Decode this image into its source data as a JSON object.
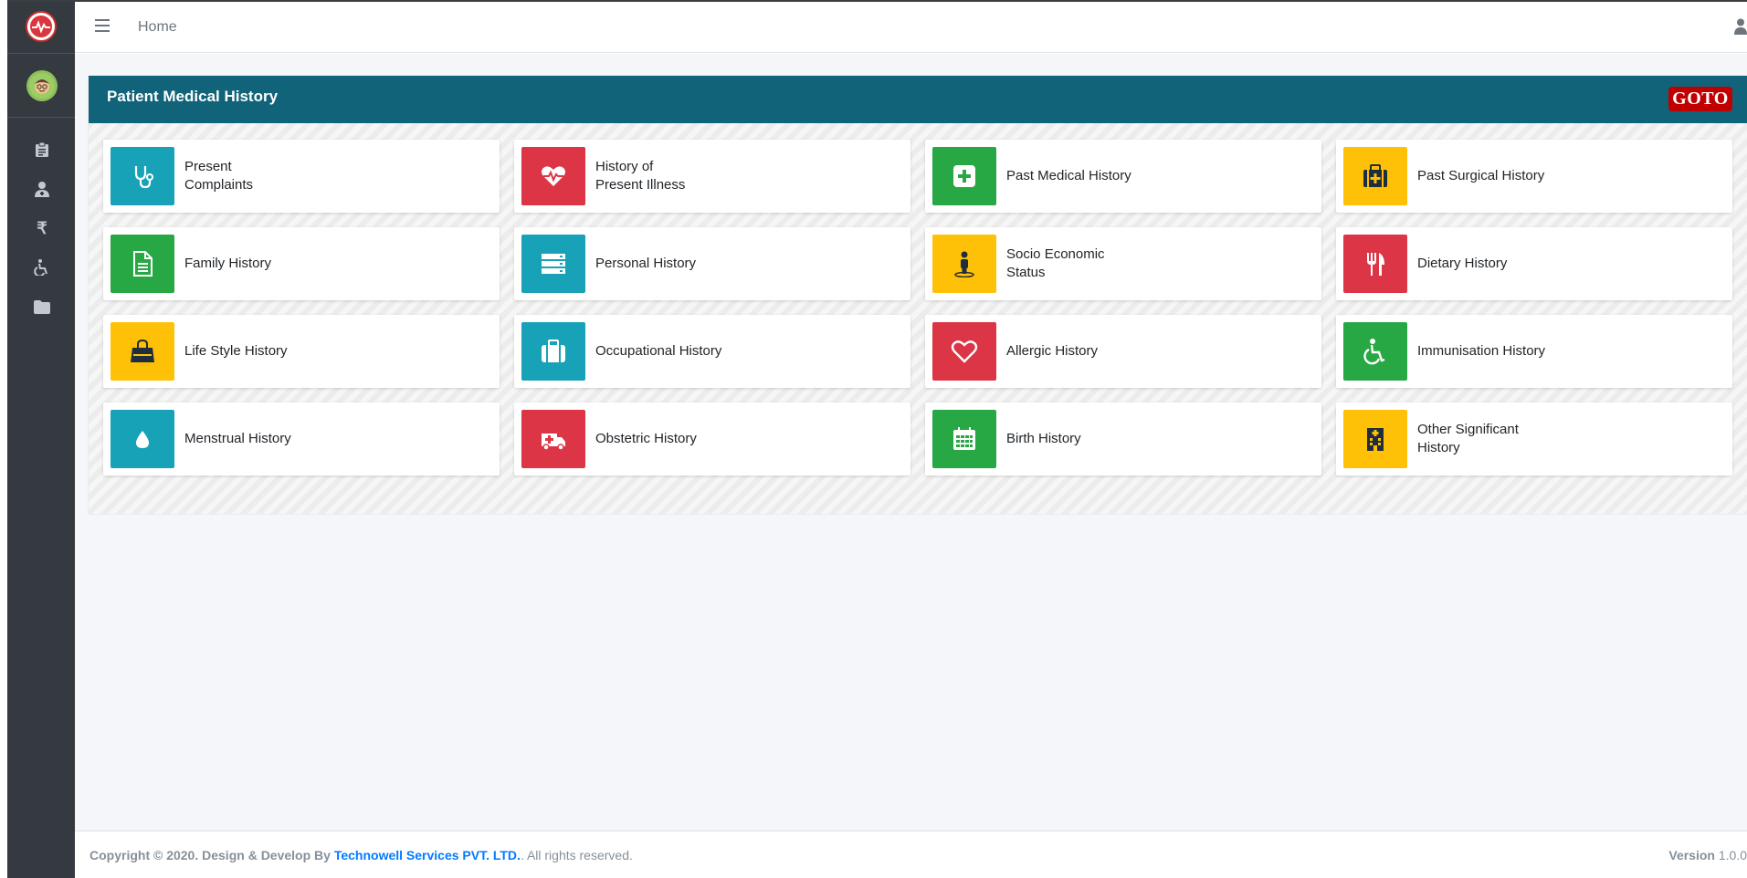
{
  "header": {
    "home_label": "Home"
  },
  "panel": {
    "title": "Patient Medical History",
    "goto_label": "GOTO"
  },
  "tiles": [
    {
      "line1": "Present",
      "line2": "Complaints",
      "icon": "stethoscope-icon",
      "color": "#17a2b8"
    },
    {
      "line1": "History of",
      "line2": "Present Illness",
      "icon": "heartbeat-icon",
      "color": "#dc3545"
    },
    {
      "line1": "Past Medical History",
      "line2": "",
      "icon": "medical-plus-icon",
      "color": "#28a745"
    },
    {
      "line1": "Past Surgical History",
      "line2": "",
      "icon": "medkit-icon",
      "color": "#ffc107"
    },
    {
      "line1": "Family History",
      "line2": "",
      "icon": "document-icon",
      "color": "#28a745"
    },
    {
      "line1": "Personal History",
      "line2": "",
      "icon": "server-icon",
      "color": "#17a2b8"
    },
    {
      "line1": "Socio Economic",
      "line2": "Status",
      "icon": "person-pin-icon",
      "color": "#ffc107"
    },
    {
      "line1": "Dietary History",
      "line2": "",
      "icon": "utensils-icon",
      "color": "#dc3545"
    },
    {
      "line1": "Life Style History",
      "line2": "",
      "icon": "shopping-bag-icon",
      "color": "#ffc107"
    },
    {
      "line1": "Occupational History",
      "line2": "",
      "icon": "briefcase-icon",
      "color": "#17a2b8"
    },
    {
      "line1": "Allergic History",
      "line2": "",
      "icon": "heart-outline-icon",
      "color": "#dc3545"
    },
    {
      "line1": "Immunisation History",
      "line2": "",
      "icon": "wheelchair-icon",
      "color": "#28a745"
    },
    {
      "line1": "Menstrual History",
      "line2": "",
      "icon": "droplet-icon",
      "color": "#17a2b8"
    },
    {
      "line1": "Obstetric History",
      "line2": "",
      "icon": "ambulance-icon",
      "color": "#dc3545"
    },
    {
      "line1": "Birth History",
      "line2": "",
      "icon": "calendar-icon",
      "color": "#28a745"
    },
    {
      "line1": "Other Significant",
      "line2": "History",
      "icon": "hospital-icon",
      "color": "#ffc107"
    }
  ],
  "sidebar": {
    "items": [
      {
        "icon": "clipboard-icon"
      },
      {
        "icon": "user-doctor-icon"
      },
      {
        "icon": "rupee-icon",
        "glyph": "₹"
      },
      {
        "icon": "wheelchair-icon"
      },
      {
        "icon": "folder-icon"
      }
    ]
  },
  "footer": {
    "copyright": "Copyright © 2020. Design & Develop By",
    "company": "Technowell Services PVT. LTD.",
    "suffix": ". All rights reserved.",
    "version_label": "Version",
    "version_value": "1.0.0"
  }
}
